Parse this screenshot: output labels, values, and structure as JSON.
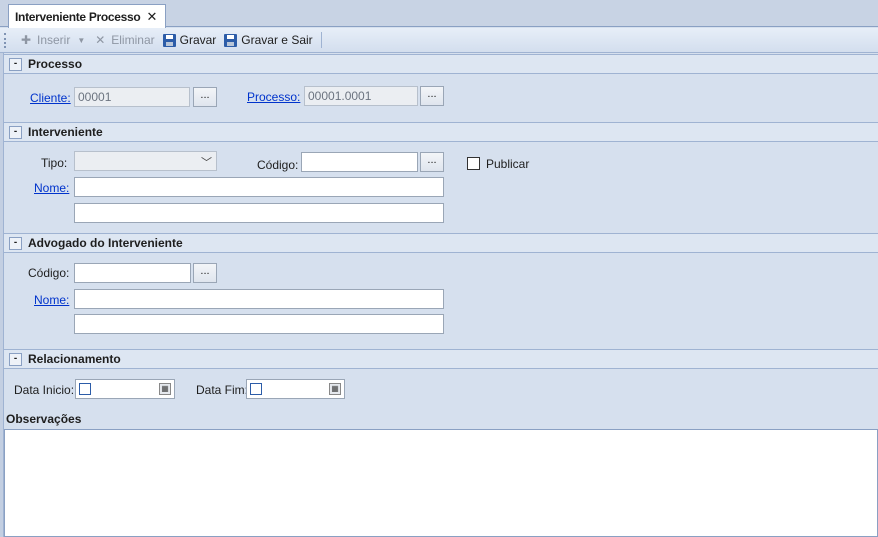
{
  "tab": {
    "label": "Interveniente Processo",
    "close": "✕"
  },
  "toolbar": {
    "insert": "Inserir",
    "delete": "Eliminar",
    "save": "Gravar",
    "save_exit": "Gravar e Sair"
  },
  "processo": {
    "title": "Processo",
    "collapse": "-",
    "cliente_label": "Cliente:",
    "cliente_value": "00001",
    "processo_label": "Processo:",
    "processo_value": "00001.0001",
    "browse": "..."
  },
  "interveniente": {
    "title": "Interveniente",
    "collapse": "-",
    "tipo_label": "Tipo:",
    "codigo_label": "Código:",
    "publicar_label": "Publicar",
    "nome_label": "Nome:",
    "browse": "..."
  },
  "advogado": {
    "title": "Advogado do Interveniente",
    "collapse": "-",
    "codigo_label": "Código:",
    "nome_label": "Nome:",
    "browse": "..."
  },
  "relacionamento": {
    "title": "Relacionamento",
    "collapse": "-",
    "data_inicio_label": "Data Inicio:",
    "data_fim_label": "Data Fim:"
  },
  "observacoes": {
    "title": "Observações"
  }
}
